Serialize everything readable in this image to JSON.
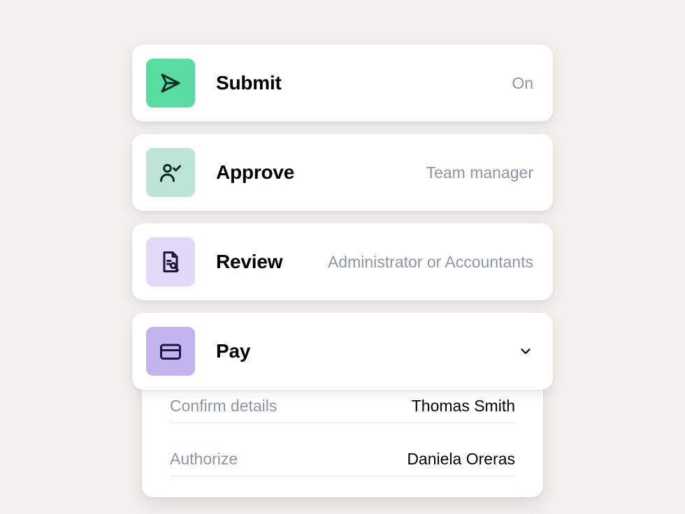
{
  "steps": {
    "submit": {
      "title": "Submit",
      "meta": "On"
    },
    "approve": {
      "title": "Approve",
      "meta": "Team manager"
    },
    "review": {
      "title": "Review",
      "meta": "Administrator or Accountants"
    },
    "pay": {
      "title": "Pay"
    }
  },
  "pay_details": {
    "rows": [
      {
        "label": "Confirm details",
        "value": "Thomas Smith"
      },
      {
        "label": "Authorize",
        "value": "Daniela Oreras"
      }
    ]
  }
}
